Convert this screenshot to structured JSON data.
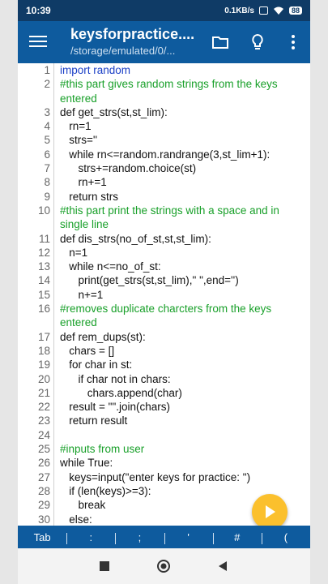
{
  "status": {
    "time": "10:39",
    "speed": "0.1KB/s",
    "battery": "88"
  },
  "appbar": {
    "title": "keysforpractice....",
    "subtitle": "/storage/emulated/0/..."
  },
  "code_lines": [
    {
      "n": "1",
      "t": "import random",
      "cls": "k"
    },
    {
      "n": "2",
      "t": "#this part gives random strings from the keys entered",
      "cls": "c"
    },
    {
      "n": "3",
      "t": "def get_strs(st,st_lim):",
      "cls": ""
    },
    {
      "n": "4",
      "t": "   rn=1",
      "cls": ""
    },
    {
      "n": "5",
      "t": "   strs=''",
      "cls": ""
    },
    {
      "n": "6",
      "t": "   while rn<=random.randrange(3,st_lim+1):",
      "cls": ""
    },
    {
      "n": "7",
      "t": "      strs+=random.choice(st)",
      "cls": ""
    },
    {
      "n": "8",
      "t": "      rn+=1",
      "cls": ""
    },
    {
      "n": "9",
      "t": "   return strs",
      "cls": ""
    },
    {
      "n": "10",
      "t": "#this part print the strings with a space and in single line",
      "cls": "c"
    },
    {
      "n": "11",
      "t": "def dis_strs(no_of_st,st,st_lim):",
      "cls": ""
    },
    {
      "n": "12",
      "t": "   n=1",
      "cls": ""
    },
    {
      "n": "13",
      "t": "   while n<=no_of_st:",
      "cls": ""
    },
    {
      "n": "14",
      "t": "      print(get_strs(st,st_lim),\" \",end='')",
      "cls": ""
    },
    {
      "n": "15",
      "t": "      n+=1",
      "cls": ""
    },
    {
      "n": "16",
      "t": "#removes duplicate charcters from the keys entered",
      "cls": "c"
    },
    {
      "n": "17",
      "t": "def rem_dups(st):",
      "cls": ""
    },
    {
      "n": "18",
      "t": "   chars = []",
      "cls": ""
    },
    {
      "n": "19",
      "t": "   for char in st:",
      "cls": ""
    },
    {
      "n": "20",
      "t": "      if char not in chars:",
      "cls": ""
    },
    {
      "n": "21",
      "t": "         chars.append(char)",
      "cls": ""
    },
    {
      "n": "22",
      "t": "   result = \"\".join(chars)",
      "cls": ""
    },
    {
      "n": "23",
      "t": "   return result",
      "cls": ""
    },
    {
      "n": "24",
      "t": "",
      "cls": ""
    },
    {
      "n": "25",
      "t": "#inputs from user",
      "cls": "c"
    },
    {
      "n": "26",
      "t": "while True:",
      "cls": ""
    },
    {
      "n": "27",
      "t": "   keys=input(\"enter keys for practice: \")",
      "cls": ""
    },
    {
      "n": "28",
      "t": "   if (len(keys)>=3):",
      "cls": ""
    },
    {
      "n": "29",
      "t": "      break",
      "cls": ""
    },
    {
      "n": "30",
      "t": "   else:",
      "cls": ""
    }
  ],
  "keybar": {
    "keys": [
      "Tab",
      ":",
      ";",
      "'",
      "#",
      "("
    ]
  },
  "colors": {
    "appbar": "#0e5b9e",
    "statusbar": "#0f3b66",
    "fab": "#fbc02d"
  }
}
